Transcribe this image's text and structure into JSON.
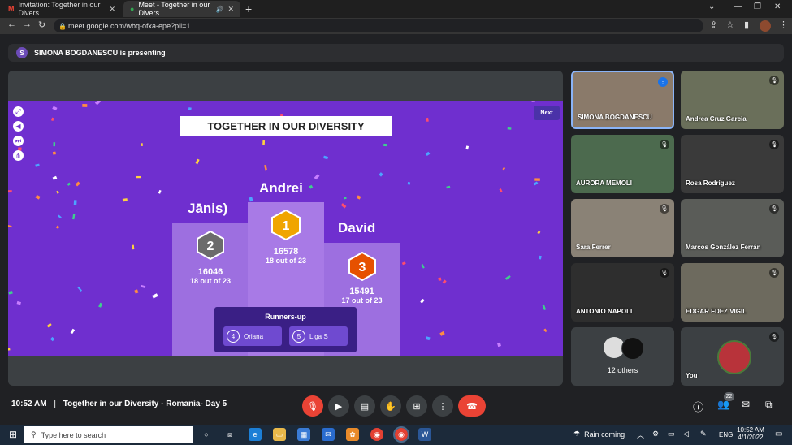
{
  "browser": {
    "tabs": [
      {
        "label": "Invitation: Together in our Divers",
        "icon": "gmail-icon"
      },
      {
        "label": "Meet - Together in our Divers",
        "icon": "meet-icon"
      }
    ],
    "url": "meet.google.com/wbq-ofxa-epe?pli=1"
  },
  "presenting_bar": {
    "avatar_initial": "S",
    "text": "SIMONA BOGDANESCU is presenting"
  },
  "slide": {
    "title": "TOGETHER IN OUR DIVERSITY",
    "next_label": "Next",
    "podium": [
      {
        "rank": "1",
        "name": "Andrei",
        "score": "16578",
        "detail": "18 out of 23",
        "color": "#f0a500"
      },
      {
        "rank": "2",
        "name": "Jānis)",
        "score": "16046",
        "detail": "18 out of 23",
        "color": "#6b6b6b"
      },
      {
        "rank": "3",
        "name": "David",
        "score": "15491",
        "detail": "17 out of 23",
        "color": "#e65100"
      }
    ],
    "runners_up": {
      "title": "Runners-up",
      "items": [
        {
          "rank": "4",
          "name": "Oriana"
        },
        {
          "rank": "5",
          "name": "Liga S"
        }
      ]
    }
  },
  "participants": [
    {
      "name": "SIMONA BOGDANESCU",
      "bg": "#8a7a6a"
    },
    {
      "name": "Andrea Cruz Garcia",
      "bg": "#6a6f5a"
    },
    {
      "name": "AURORA MEMOLI",
      "bg": "#4c6a4e"
    },
    {
      "name": "Rosa Rodriguez",
      "bg": "#3a3a3a"
    },
    {
      "name": "Sara Ferrer",
      "bg": "#8a8276"
    },
    {
      "name": "Marcos González Ferrán",
      "bg": "#5a5c58"
    },
    {
      "name": "ANTONIO NAPOLI",
      "bg": "#2e2e2e"
    },
    {
      "name": "EDGAR FDEZ VIGIL",
      "bg": "#6d6a5e"
    }
  ],
  "others_tile": {
    "label": "12 others"
  },
  "you_tile": {
    "label": "You"
  },
  "bottom_bar": {
    "time": "10:52 AM",
    "separator": "|",
    "meeting_name": "Together in our Diversity - Romania- Day 5",
    "people_count": "22"
  },
  "taskbar": {
    "search_placeholder": "Type here to search",
    "weather": "Rain coming",
    "language": "ENG",
    "clock_time": "10:52 AM",
    "clock_date": "4/1/2022"
  },
  "colors": {
    "accent": "#6f2fcf",
    "end_call": "#ea4335",
    "mic_off": "#ea4335"
  }
}
